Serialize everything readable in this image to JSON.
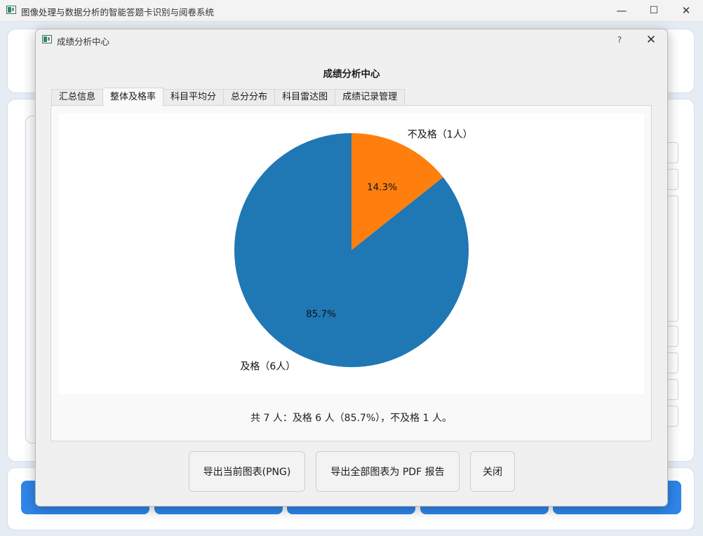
{
  "main_window": {
    "title": "图像处理与数据分析的智能答题卡识别与阅卷系统",
    "controls": {
      "minimize": "—",
      "maximize": "☐",
      "close": "✕"
    }
  },
  "dialog": {
    "title": "成绩分析中心",
    "help": "?",
    "close": "✕",
    "heading": "成绩分析中心",
    "tabs": [
      {
        "label": "汇总信息",
        "active": false
      },
      {
        "label": "整体及格率",
        "active": true
      },
      {
        "label": "科目平均分",
        "active": false
      },
      {
        "label": "总分分布",
        "active": false
      },
      {
        "label": "科目雷达图",
        "active": false
      },
      {
        "label": "成绩记录管理",
        "active": false
      }
    ],
    "summary": "共 7 人：及格 6 人（85.7%），不及格 1 人。",
    "buttons": {
      "export_png": "导出当前图表(PNG)",
      "export_pdf": "导出全部图表为 PDF 报告",
      "close": "关闭"
    }
  },
  "chart_data": {
    "type": "pie",
    "title": "",
    "slices": [
      {
        "label": "不及格（1人）",
        "value": 1,
        "percent_label": "14.3%",
        "color": "#ff7f0e"
      },
      {
        "label": "及格（6人）",
        "value": 6,
        "percent_label": "85.7%",
        "color": "#1f77b4"
      }
    ],
    "start_angle_deg": 90,
    "direction": "clockwise"
  }
}
